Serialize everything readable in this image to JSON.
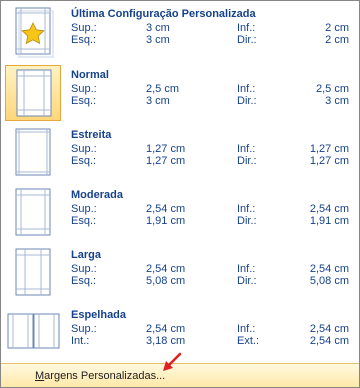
{
  "presets": [
    {
      "name": "Última Configuração Personalizada",
      "rows": [
        {
          "label_left": "Sup.:",
          "value_left": "3 cm",
          "label_right": "Inf.:",
          "value_right": "2 cm"
        },
        {
          "label_left": "Esq.:",
          "value_left": "3 cm",
          "label_right": "Dir.:",
          "value_right": "2 cm"
        }
      ],
      "icon": "star-page-icon",
      "selected": false
    },
    {
      "name": "Normal",
      "rows": [
        {
          "label_left": "Sup.:",
          "value_left": "2,5 cm",
          "label_right": "Inf.:",
          "value_right": "2,5 cm"
        },
        {
          "label_left": "Esq.:",
          "value_left": "3 cm",
          "label_right": "Dir.:",
          "value_right": "3 cm"
        }
      ],
      "icon": "page-margins-icon",
      "selected": true
    },
    {
      "name": "Estreita",
      "rows": [
        {
          "label_left": "Sup.:",
          "value_left": "1,27 cm",
          "label_right": "Inf.:",
          "value_right": "1,27 cm"
        },
        {
          "label_left": "Esq.:",
          "value_left": "1,27 cm",
          "label_right": "Dir.:",
          "value_right": "1,27 cm"
        }
      ],
      "icon": "page-margins-icon",
      "selected": false
    },
    {
      "name": "Moderada",
      "rows": [
        {
          "label_left": "Sup.:",
          "value_left": "2,54 cm",
          "label_right": "Inf.:",
          "value_right": "2,54 cm"
        },
        {
          "label_left": "Esq.:",
          "value_left": "1,91 cm",
          "label_right": "Dir.:",
          "value_right": "1,91 cm"
        }
      ],
      "icon": "page-margins-icon",
      "selected": false
    },
    {
      "name": "Larga",
      "rows": [
        {
          "label_left": "Sup.:",
          "value_left": "2,54 cm",
          "label_right": "Inf.:",
          "value_right": "2,54 cm"
        },
        {
          "label_left": "Esq.:",
          "value_left": "5,08 cm",
          "label_right": "Dir.:",
          "value_right": "5,08 cm"
        }
      ],
      "icon": "page-margins-icon",
      "selected": false
    },
    {
      "name": "Espelhada",
      "rows": [
        {
          "label_left": "Sup.:",
          "value_left": "2,54 cm",
          "label_right": "Inf.:",
          "value_right": "2,54 cm"
        },
        {
          "label_left": "Int.:",
          "value_left": "3,18 cm",
          "label_right": "Ext.:",
          "value_right": "2,54 cm"
        }
      ],
      "icon": "mirrored-pages-icon",
      "selected": false
    }
  ],
  "footer": {
    "custom_margins_label": "argens Personalizadas...",
    "custom_margins_accesskey": "M"
  },
  "colors": {
    "text": "#15428b",
    "selected_fill": "#ffd77a",
    "footer_fill": "#ffe9a8",
    "arrow": "#e02020"
  }
}
